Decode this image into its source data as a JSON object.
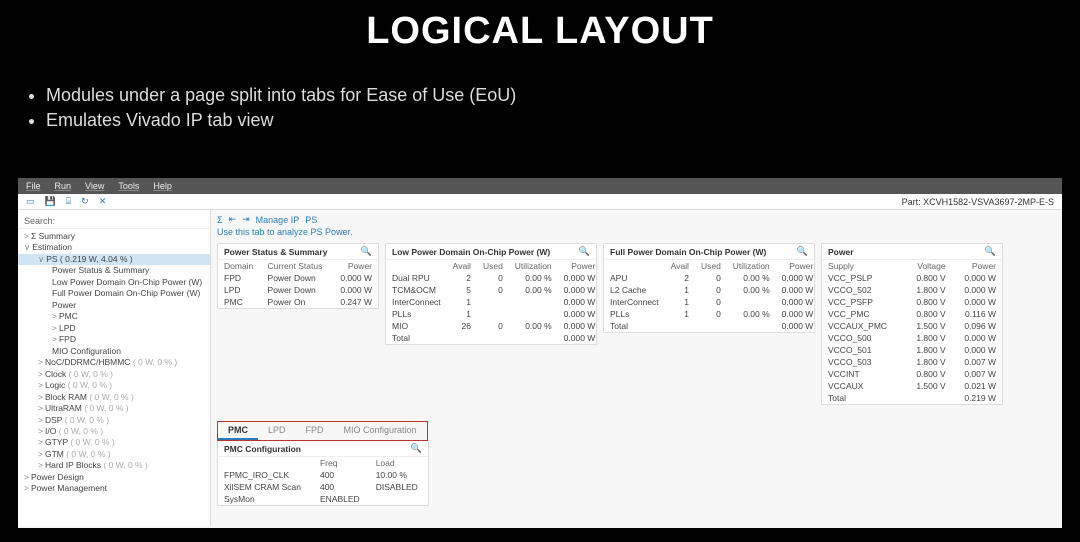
{
  "slide": {
    "title": "LOGICAL LAYOUT",
    "bullets": [
      "Modules under a page split into tabs for Ease of Use (EoU)",
      "Emulates Vivado IP tab view"
    ]
  },
  "menu": [
    "File",
    "Run",
    "View",
    "Tools",
    "Help"
  ],
  "part_label": "Part: XCVH1582-VSVA3697-2MP-E-S",
  "search_placeholder": "Search:",
  "tree": [
    {
      "lvl": 1,
      "tw": ">",
      "label": "Σ Summary"
    },
    {
      "lvl": 1,
      "tw": "∨",
      "label": "Estimation"
    },
    {
      "lvl": 2,
      "tw": "∨",
      "label": "PS ( 0.219 W, 4.04 % )",
      "sel": true
    },
    {
      "lvl": 3,
      "label": "Power Status & Summary"
    },
    {
      "lvl": 3,
      "label": "Low Power Domain On-Chip Power (W)"
    },
    {
      "lvl": 3,
      "label": "Full Power Domain On-Chip Power (W)"
    },
    {
      "lvl": 3,
      "label": "Power"
    },
    {
      "lvl": 3,
      "tw": ">",
      "label": "PMC"
    },
    {
      "lvl": 3,
      "tw": ">",
      "label": "LPD"
    },
    {
      "lvl": 3,
      "tw": ">",
      "label": "FPD"
    },
    {
      "lvl": 3,
      "label": "MIO Configuration"
    },
    {
      "lvl": 2,
      "tw": ">",
      "label": "NoC/DDRMC/HBMMC",
      "dim": "( 0 W, 0 % )"
    },
    {
      "lvl": 2,
      "tw": ">",
      "label": "Clock",
      "dim": "( 0 W, 0 % )"
    },
    {
      "lvl": 2,
      "tw": ">",
      "label": "Logic",
      "dim": "( 0 W, 0 % )"
    },
    {
      "lvl": 2,
      "tw": ">",
      "label": "Block RAM",
      "dim": "( 0 W, 0 % )"
    },
    {
      "lvl": 2,
      "tw": ">",
      "label": "UltraRAM",
      "dim": "( 0 W, 0 % )"
    },
    {
      "lvl": 2,
      "tw": ">",
      "label": "DSP",
      "dim": "( 0 W, 0 % )"
    },
    {
      "lvl": 2,
      "tw": ">",
      "label": "I/O",
      "dim": "( 0 W, 0 % )"
    },
    {
      "lvl": 2,
      "tw": ">",
      "label": "GTYP",
      "dim": "( 0 W, 0 % )"
    },
    {
      "lvl": 2,
      "tw": ">",
      "label": "GTM",
      "dim": "( 0 W, 0 % )"
    },
    {
      "lvl": 2,
      "tw": ">",
      "label": "Hard IP Blocks",
      "dim": "( 0 W, 0 % )"
    },
    {
      "lvl": 1,
      "tw": ">",
      "label": "Power Design"
    },
    {
      "lvl": 1,
      "tw": ">",
      "label": "Power Management"
    }
  ],
  "banner": {
    "manage": "Manage IP",
    "ps": "PS"
  },
  "hint": "Use this tab to analyze PS Power.",
  "panels": {
    "status": {
      "title": "Power Status & Summary",
      "headers": [
        "Domain",
        "Current Status",
        "Power"
      ],
      "rows": [
        [
          "FPD",
          "Power Down",
          "0.000 W"
        ],
        [
          "LPD",
          "Power Down",
          "0.000 W"
        ],
        [
          "PMC",
          "Power On",
          "0.247 W"
        ]
      ]
    },
    "lpd": {
      "title": "Low Power Domain On-Chip Power (W)",
      "headers": [
        "",
        "Avail",
        "Used",
        "Utilization",
        "Power"
      ],
      "rows": [
        [
          "Dual RPU",
          "2",
          "0",
          "0.00 %",
          "0.000 W"
        ],
        [
          "TCM&OCM",
          "5",
          "0",
          "0.00 %",
          "0.000 W"
        ],
        [
          "InterConnect",
          "1",
          "",
          "",
          "0.000 W"
        ],
        [
          "PLLs",
          "1",
          "",
          "",
          "0.000 W"
        ],
        [
          "MIO",
          "26",
          "0",
          "0.00 %",
          "0.000 W"
        ],
        [
          "Total",
          "",
          "",
          "",
          "0.000 W"
        ]
      ]
    },
    "fpd": {
      "title": "Full Power Domain On-Chip Power (W)",
      "headers": [
        "",
        "Avail",
        "Used",
        "Utilization",
        "Power"
      ],
      "rows": [
        [
          "APU",
          "2",
          "0",
          "0.00 %",
          "0.000 W"
        ],
        [
          "L2 Cache",
          "1",
          "0",
          "0.00 %",
          "0.000 W"
        ],
        [
          "InterConnect",
          "1",
          "0",
          "",
          "0.000 W"
        ],
        [
          "PLLs",
          "1",
          "0",
          "0.00 %",
          "0.000 W"
        ],
        [
          "Total",
          "",
          "",
          "",
          "0.000 W"
        ]
      ]
    },
    "power": {
      "title": "Power",
      "headers": [
        "Supply",
        "Voltage",
        "Power"
      ],
      "rows": [
        [
          "VCC_PSLP",
          "0.800 V",
          "0.000 W"
        ],
        [
          "VCCO_502",
          "1.800 V",
          "0.000 W"
        ],
        [
          "VCC_PSFP",
          "0.800 V",
          "0.000 W"
        ],
        [
          "VCC_PMC",
          "0.800 V",
          "0.116 W"
        ],
        [
          "VCCAUX_PMC",
          "1.500 V",
          "0.096 W"
        ],
        [
          "VCCO_500",
          "1.800 V",
          "0.000 W"
        ],
        [
          "VCCO_501",
          "1.800 V",
          "0.000 W"
        ],
        [
          "VCCO_503",
          "1.800 V",
          "0.007 W"
        ],
        [
          "VCCINT",
          "0.800 V",
          "0.007 W"
        ],
        [
          "VCCAUX",
          "1.500 V",
          "0.021 W"
        ],
        [
          "Total",
          "",
          "0.219 W"
        ]
      ]
    }
  },
  "tabs": [
    "PMC",
    "LPD",
    "FPD",
    "MIO Configuration"
  ],
  "cfg": {
    "title": "PMC Configuration",
    "headers": [
      "",
      "Freq",
      "Load"
    ],
    "rows": [
      [
        "FPMC_IRO_CLK",
        "400",
        "10.00 %"
      ],
      [
        "XilSEM CRAM Scan",
        "400",
        "DISABLED"
      ],
      [
        "SysMon",
        "ENABLED",
        ""
      ]
    ]
  }
}
